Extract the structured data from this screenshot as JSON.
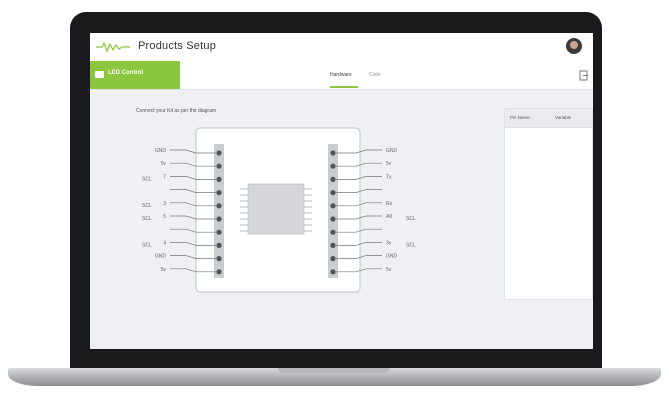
{
  "app": {
    "title": "Products Setup",
    "logo_icon": "wave-logo-icon",
    "avatar_icon": "user-avatar-icon",
    "accent_color": "#8cc63f"
  },
  "project": {
    "name": "LED Control",
    "icon": "board-icon"
  },
  "tabs": [
    {
      "label": "Hardware",
      "active": true
    },
    {
      "label": "Code",
      "active": false
    }
  ],
  "exit_icon": "exit-icon",
  "instruction": "Connect your Kit as per the diagram",
  "pins_left": [
    {
      "aux": "",
      "label": "GND"
    },
    {
      "aux": "",
      "label": "5v"
    },
    {
      "aux": "SCL",
      "label": "7"
    },
    {
      "aux": "",
      "label": ""
    },
    {
      "aux": "SCL",
      "label": "3"
    },
    {
      "aux": "SCL",
      "label": "5"
    },
    {
      "aux": "",
      "label": ""
    },
    {
      "aux": "SCL",
      "label": "4"
    },
    {
      "aux": "",
      "label": "GND"
    },
    {
      "aux": "",
      "label": "5v"
    }
  ],
  "pins_right": [
    {
      "label": "GND",
      "aux": ""
    },
    {
      "label": "5v",
      "aux": ""
    },
    {
      "label": "Tx",
      "aux": ""
    },
    {
      "label": "",
      "aux": ""
    },
    {
      "label": "Rx",
      "aux": ""
    },
    {
      "label": "A0",
      "aux": "SCL"
    },
    {
      "label": "",
      "aux": ""
    },
    {
      "label": "3v",
      "aux": "SCL"
    },
    {
      "label": "GND",
      "aux": ""
    },
    {
      "label": "5v",
      "aux": ""
    }
  ],
  "side_panel": {
    "columns": [
      "Pin Name",
      "Variable"
    ]
  }
}
